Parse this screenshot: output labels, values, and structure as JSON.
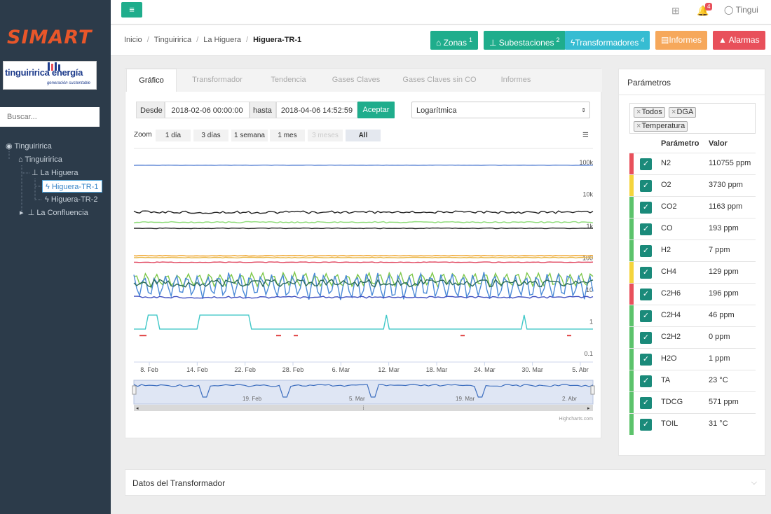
{
  "app": {
    "logo_text": "SIMART",
    "brand_name": "tinguiririca energía",
    "brand_tagline": "generación sustentable"
  },
  "sidebar": {
    "search_placeholder": "Buscar...",
    "tree": [
      {
        "label": "Tinguiririca",
        "icon": "globe-icon"
      },
      {
        "label": "Tinguiririca",
        "icon": "bank-icon"
      },
      {
        "label": "La Higuera",
        "icon": "sitemap-icon"
      },
      {
        "label": "Higuera-TR-1",
        "icon": "bolt-icon",
        "selected": true
      },
      {
        "label": "Higuera-TR-2",
        "icon": "bolt-icon"
      },
      {
        "label": "La Confluencia",
        "icon": "sitemap-icon"
      }
    ]
  },
  "topbar": {
    "notifications": "4",
    "user": "Tingui"
  },
  "breadcrumb": [
    "Inicio",
    "Tinguiririca",
    "La Higuera",
    "Higuera-TR-1"
  ],
  "actions": [
    {
      "label": "Zonas",
      "count": "1",
      "color": "#1fad8c"
    },
    {
      "label": "Subestaciones",
      "count": "2",
      "color": "#1fad8c"
    },
    {
      "label": "Transformadores",
      "count": "4",
      "color": "#36bcd2"
    },
    {
      "label": "Informes",
      "count": "",
      "color": "#f6a85b"
    },
    {
      "label": "Alarmas",
      "count": "",
      "color": "#e8505b"
    }
  ],
  "tabs": [
    "Gráfico",
    "Transformador",
    "Tendencia",
    "Gases Claves",
    "Gases Claves sin CO",
    "Informes"
  ],
  "filter": {
    "from_label": "Desde",
    "from": "2018-02-06 00:00:00",
    "to_label": "hasta",
    "to": "2018-04-06 14:52:59",
    "accept": "Aceptar",
    "scale": "Logarítmica"
  },
  "zoom": {
    "label": "Zoom",
    "options": [
      "1 día",
      "3 días",
      "1 semana",
      "1 mes",
      "3 meses",
      "All"
    ]
  },
  "chart_data": {
    "type": "line",
    "y_scale": "log",
    "ylim": [
      0.1,
      150000
    ],
    "y_ticks": [
      "100k",
      "10k",
      "1k",
      "100",
      "10",
      "1",
      "0.1"
    ],
    "x_ticks": [
      "8. Feb",
      "14. Feb",
      "22. Feb",
      "28. Feb",
      "6. Mar",
      "12. Mar",
      "18. Mar",
      "24. Mar",
      "30. Mar",
      "5. Abr"
    ],
    "navigator_ticks": [
      "19. Feb",
      "5. Mar",
      "19. Mar",
      "2. Abr"
    ],
    "credit": "Highcharts.com",
    "series": [
      {
        "color": "#6a8fd8",
        "level": 110755,
        "noise": 0.005,
        "style": "flat"
      },
      {
        "color": "#222222",
        "level": 3730,
        "noise": 0.04,
        "style": "flat"
      },
      {
        "color": "#8fdc7a",
        "level": 1800,
        "noise": 0.02,
        "style": "flat"
      },
      {
        "color": "#222222",
        "level": 1163,
        "noise": 0.01,
        "style": "flat"
      },
      {
        "color": "#f0a020",
        "level": 160,
        "noise": 0.01,
        "style": "flat"
      },
      {
        "color": "#e8b84a",
        "level": 140,
        "noise": 0.01,
        "style": "flat"
      },
      {
        "color": "#e0405a",
        "level": 100,
        "noise": 0.01,
        "style": "flat"
      },
      {
        "color": "#7ec84a",
        "level": 28,
        "noise": 0.25,
        "style": "wave"
      },
      {
        "color": "#4a8ad8",
        "level": 18,
        "noise": 0.45,
        "style": "wave"
      },
      {
        "color": "#2a6a5a",
        "level": 22,
        "noise": 0.12,
        "style": "flat"
      },
      {
        "color": "#4050c0",
        "level": 8,
        "noise": 0.03,
        "style": "flat"
      },
      {
        "color": "#40c8c8",
        "level": 1.2,
        "noise": 0.0,
        "style": "step"
      },
      {
        "color": "#e04040",
        "level": 0.5,
        "noise": 0.0,
        "style": "dots"
      }
    ]
  },
  "parameters": {
    "title": "Parámetros",
    "tags": [
      "Todos",
      "DGA",
      "Temperatura"
    ],
    "col_param": "Parámetro",
    "col_value": "Valor",
    "rows": [
      {
        "name": "N2",
        "value": "110755 ppm",
        "status": "#e8505b"
      },
      {
        "name": "O2",
        "value": "3730 ppm",
        "status": "#f5d43c"
      },
      {
        "name": "CO2",
        "value": "1163 ppm",
        "status": "#5cc36b"
      },
      {
        "name": "CO",
        "value": "193 ppm",
        "status": "#5cc36b"
      },
      {
        "name": "H2",
        "value": "7 ppm",
        "status": "#5cc36b"
      },
      {
        "name": "CH4",
        "value": "129 ppm",
        "status": "#f5d43c"
      },
      {
        "name": "C2H6",
        "value": "196 ppm",
        "status": "#e8505b"
      },
      {
        "name": "C2H4",
        "value": "46 ppm",
        "status": "#5cc36b"
      },
      {
        "name": "C2H2",
        "value": "0 ppm",
        "status": "#5cc36b"
      },
      {
        "name": "H2O",
        "value": "1 ppm",
        "status": "#5cc36b"
      },
      {
        "name": "TA",
        "value": "23 °C",
        "status": "#5cc36b"
      },
      {
        "name": "TDCG",
        "value": "571 ppm",
        "status": "#5cc36b"
      },
      {
        "name": "TOIL",
        "value": "31 °C",
        "status": "#5cc36b"
      }
    ]
  },
  "footer_section": "Datos del Transformador"
}
